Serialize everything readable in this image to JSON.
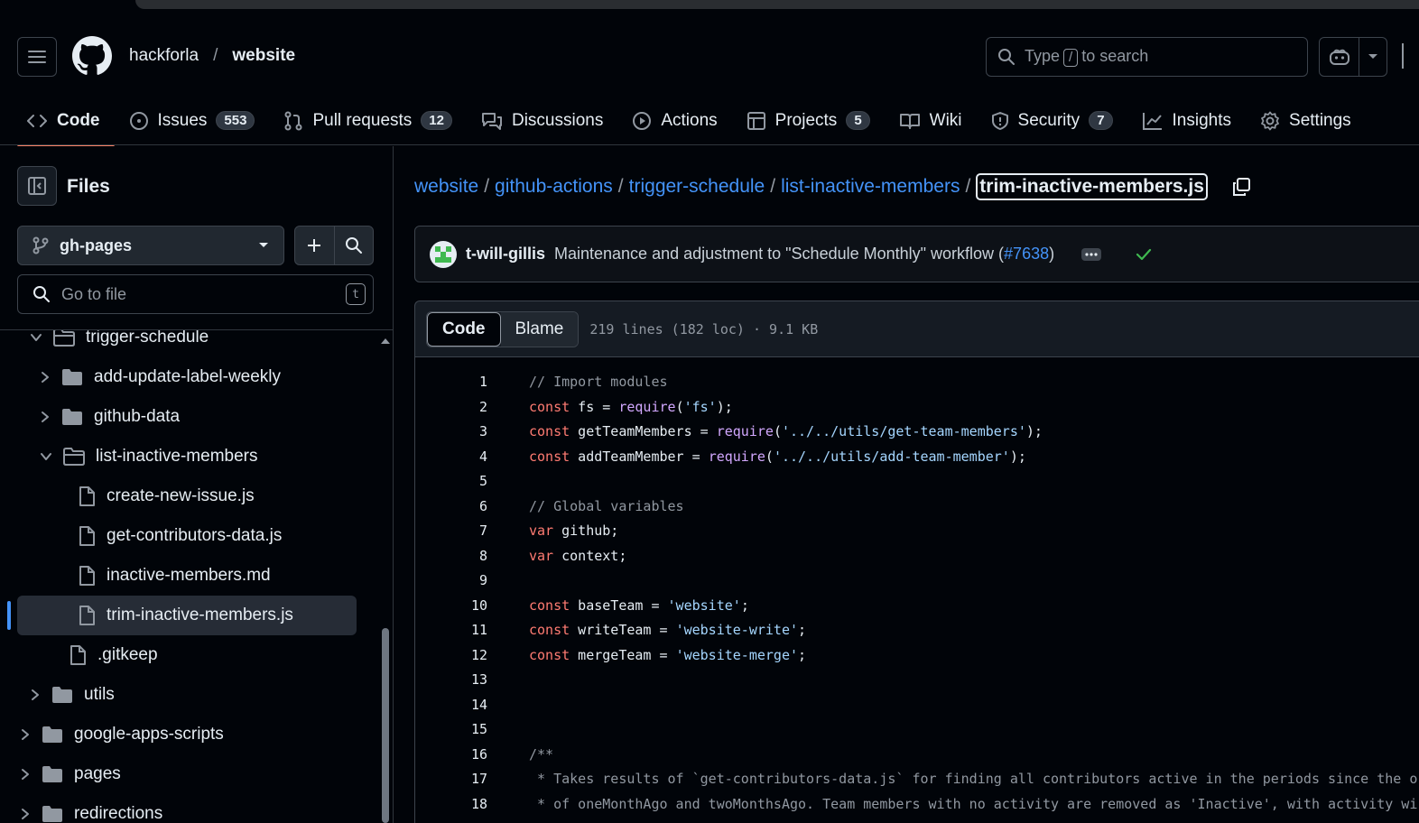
{
  "header": {
    "owner": "hackforla",
    "separator": "/",
    "repo": "website",
    "search": {
      "pre": "Type",
      "key": "/",
      "post": "to search"
    }
  },
  "tabs": [
    {
      "label": "Code",
      "icon": "code-icon",
      "count": ""
    },
    {
      "label": "Issues",
      "icon": "issue-icon",
      "count": "553"
    },
    {
      "label": "Pull requests",
      "icon": "pull-request-icon",
      "count": "12"
    },
    {
      "label": "Discussions",
      "icon": "discussion-icon",
      "count": ""
    },
    {
      "label": "Actions",
      "icon": "play-icon",
      "count": ""
    },
    {
      "label": "Projects",
      "icon": "table-icon",
      "count": "5"
    },
    {
      "label": "Wiki",
      "icon": "book-icon",
      "count": ""
    },
    {
      "label": "Security",
      "icon": "shield-icon",
      "count": "7"
    },
    {
      "label": "Insights",
      "icon": "graph-icon",
      "count": ""
    },
    {
      "label": "Settings",
      "icon": "gear-icon",
      "count": ""
    }
  ],
  "sidebar": {
    "title": "Files",
    "branch": "gh-pages",
    "goto_placeholder": "Go to file",
    "goto_key": "t",
    "tree": [
      {
        "label": "trigger-schedule",
        "type": "folder-open",
        "depth": 1
      },
      {
        "label": "add-update-label-weekly",
        "type": "folder",
        "depth": 2
      },
      {
        "label": "github-data",
        "type": "folder",
        "depth": 2
      },
      {
        "label": "list-inactive-members",
        "type": "folder-open",
        "depth": 2
      },
      {
        "label": "create-new-issue.js",
        "type": "file",
        "depth": 3
      },
      {
        "label": "get-contributors-data.js",
        "type": "file",
        "depth": 3
      },
      {
        "label": "inactive-members.md",
        "type": "file",
        "depth": 3
      },
      {
        "label": "trim-inactive-members.js",
        "type": "file",
        "depth": 3,
        "selected": true
      },
      {
        "label": ".gitkeep",
        "type": "file",
        "depth": 2
      },
      {
        "label": "utils",
        "type": "folder",
        "depth": 1
      },
      {
        "label": "google-apps-scripts",
        "type": "folder",
        "depth": 0
      },
      {
        "label": "pages",
        "type": "folder",
        "depth": 0
      },
      {
        "label": "redirections",
        "type": "folder",
        "depth": 0
      }
    ]
  },
  "breadcrumbs": {
    "parts": [
      "website",
      "github-actions",
      "trigger-schedule",
      "list-inactive-members"
    ],
    "current": "trim-inactive-members.js"
  },
  "commit": {
    "author": "t-will-gillis",
    "message": "Maintenance and adjustment to \"Schedule Monthly\" workflow (",
    "pr": "#7638",
    "close": ")"
  },
  "file": {
    "code_tab": "Code",
    "blame_tab": "Blame",
    "meta": "219 lines (182 loc) · 9.1 KB"
  },
  "code_lines": [
    "// Import modules",
    "const fs = require('fs');",
    "const getTeamMembers = require('../../utils/get-team-members');",
    "const addTeamMember = require('../../utils/add-team-member');",
    "",
    "// Global variables",
    "var github;",
    "var context;",
    "",
    "const baseTeam = 'website';",
    "const writeTeam = 'website-write';",
    "const mergeTeam = 'website-merge';",
    "",
    "",
    "",
    "/**",
    " * Takes results of `get-contributors-data.js` for finding all contributors active in the periods since the o",
    " * of oneMonthAgo and twoMonthsAgo. Team members with no activity are removed as 'Inactive', with activity wi"
  ],
  "colors": {
    "accent": "#4493f8",
    "tab_underline": "#f78166",
    "success": "#3fb950"
  }
}
